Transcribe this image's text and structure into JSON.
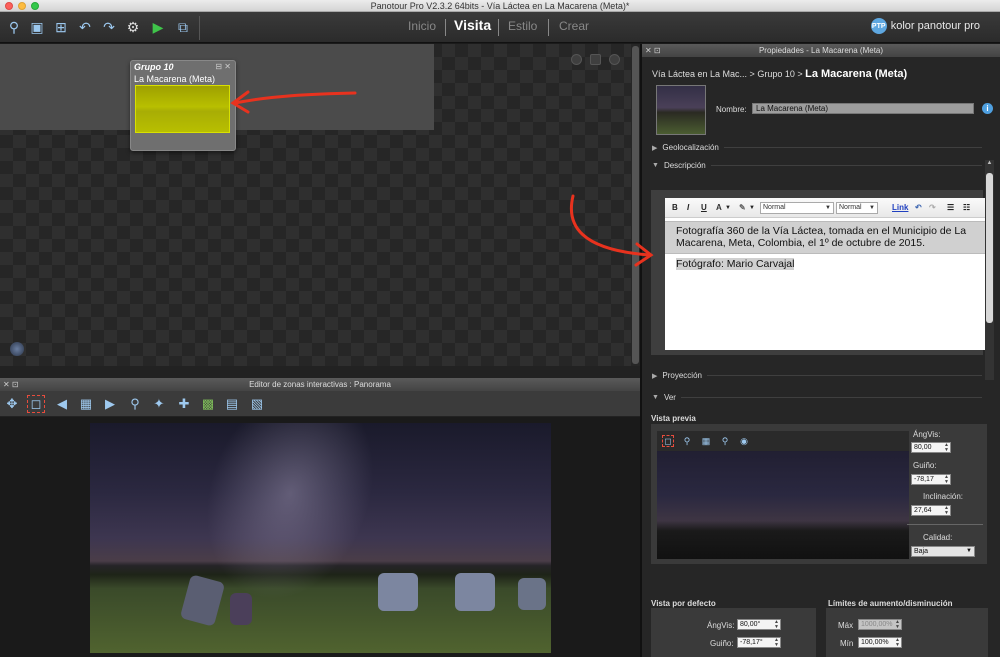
{
  "window": {
    "title": "Panotour Pro V2.3.2 64bits - Vía Láctea en La Macarena (Meta)*"
  },
  "toolbar": {
    "buttons": [
      {
        "name": "search-tour-icon",
        "glyph": "⚲"
      },
      {
        "name": "save-icon",
        "glyph": "▣"
      },
      {
        "name": "add-panorama-icon",
        "glyph": "⊞"
      },
      {
        "name": "undo-icon",
        "glyph": "↶"
      },
      {
        "name": "redo-icon",
        "glyph": "↷"
      },
      {
        "name": "gear-icon",
        "glyph": "⚙"
      },
      {
        "name": "play-icon",
        "glyph": "▶"
      },
      {
        "name": "build-icon",
        "glyph": "⧉"
      }
    ],
    "nav": {
      "inicio": "Inicio",
      "visita": "Visita",
      "estilo": "Estilo",
      "crear": "Crear"
    },
    "brand": {
      "icon_text": "PTP",
      "text": "kolor panotour pro"
    }
  },
  "canvas": {
    "group": {
      "title": "Grupo 10",
      "item_label": "La Macarena (Meta)",
      "icons": "⊟ ✕"
    }
  },
  "hotspot_editor": {
    "header": "Editor de zonas interactivas : Panorama",
    "header_icons": "✕ ⊡"
  },
  "properties": {
    "header": "Propiedades - La Macarena (Meta)",
    "header_icons": "✕ ⊡",
    "breadcrumb": {
      "path": "Vía Láctea en La Mac... > Grupo 10 > ",
      "current": "La Macarena (Meta)"
    },
    "name_label": "Nombre:",
    "name_value": "La Macarena (Meta)",
    "sections": {
      "geolocalizacion": "Geolocalización",
      "descripcion": "Descripción",
      "proyeccion": "Proyección",
      "ver": "Ver"
    },
    "editor": {
      "bold": "B",
      "italic": "I",
      "underline": "U",
      "font_color": "A",
      "format_select": "Normal",
      "size_select": "Normal",
      "link": "Link",
      "paragraph1": "Fotografía 360 de la Vía Láctea, tomada en el Municipio de La Macarena, Meta, Colombia, el 1º de octubre de 2015.",
      "paragraph2": "Fotógrafo: Mario Carvajal"
    },
    "vista_previa": {
      "label": "Vista previa",
      "angvis_label": "ÁngVis:",
      "angvis_value": "80,00",
      "guinyo_label": "Guiño:",
      "guinyo_value": "-78,17",
      "inclinacion_label": "Inclinación:",
      "inclinacion_value": "27,64",
      "calidad_label": "Calidad:",
      "calidad_value": "Baja"
    },
    "vista_defecto": {
      "label": "Vista por defecto",
      "angvis_label": "ÁngVis:",
      "angvis_value": "80,00°",
      "guinyo_label": "Guiño:",
      "guinyo_value": "-78,17°"
    },
    "limites": {
      "label": "Límites de aumento/disminución",
      "max_label": "Máx",
      "max_value": "1000,00%",
      "min_label": "Mín",
      "min_value": "100,00%"
    }
  },
  "colors": {
    "accent": "#4fa0e0",
    "arrow": "#e8321e",
    "highlight": "#b8bf00"
  }
}
